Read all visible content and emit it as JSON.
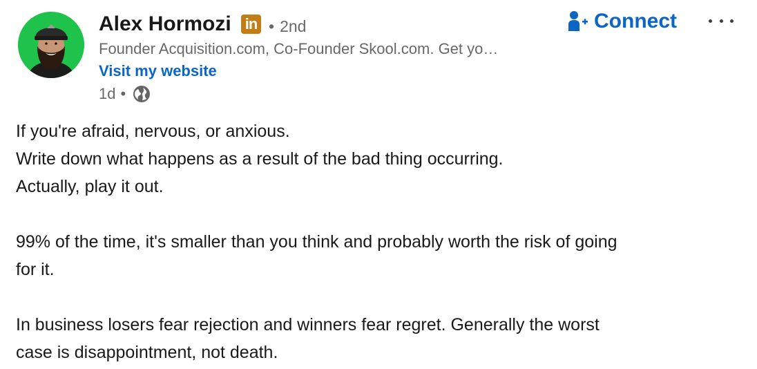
{
  "author": {
    "name": "Alex Hormozi",
    "premium_badge": "in",
    "degree_separator": "•",
    "degree": "2nd",
    "headline": "Founder Acquisition.com, Co-Founder Skool.com. Get yo…",
    "website_link": "Visit my website"
  },
  "meta": {
    "time": "1d",
    "separator": "•",
    "visibility_icon": "globe-icon"
  },
  "actions": {
    "connect_label": "Connect",
    "connect_icon": "add-person-icon",
    "more_icon": "ellipsis-icon"
  },
  "body": {
    "paragraph1": {
      "line1": "If you're afraid, nervous, or anxious.",
      "line2": "Write down what happens as a result of the bad thing occurring.",
      "line3": "Actually, play it out."
    },
    "paragraph2": {
      "line1": "99% of the time, it's smaller than you think and probably worth the risk of going",
      "line2": "for it."
    },
    "paragraph3": {
      "line1": "In business losers fear rejection and winners fear regret. Generally the worst",
      "line2": "case is disappointment, not death."
    }
  },
  "colors": {
    "link": "#0a66c2",
    "premium_badge": "#c37d16",
    "avatar_background": "#1fc24a"
  }
}
